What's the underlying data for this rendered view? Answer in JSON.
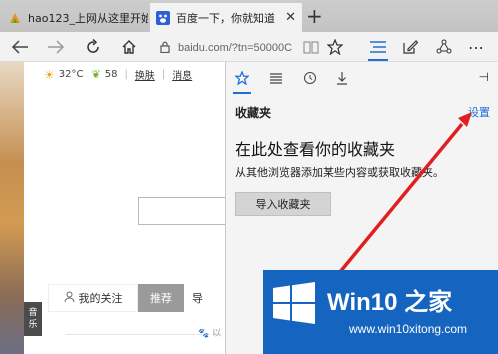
{
  "tabs": [
    {
      "title": "hao123_上网从这里开始",
      "active": false
    },
    {
      "title": "百度一下，你就知道",
      "active": true
    }
  ],
  "address_bar": {
    "url": "baidu.com/?tn=50000C"
  },
  "page": {
    "temperature": "32°C",
    "aqi": "58",
    "change_link": "换肤",
    "message_link": "消息",
    "tab_follow": "我的关注",
    "tab_recommend": "推荐",
    "tab_next": "导",
    "music_label": "音\n乐",
    "footer_hint": "以"
  },
  "hub": {
    "section_title": "收藏夹",
    "settings_link": "设置",
    "empty_heading": "在此处查看你的收藏夹",
    "empty_description": "从其他浏览器添加某些内容或获取收藏夹。",
    "import_button": "导入收藏夹",
    "tabs": [
      "favorites",
      "reading-list",
      "history",
      "downloads"
    ]
  },
  "watermark": {
    "brand": "Win10 之家",
    "url": "www.win10xitong.com"
  },
  "colors": {
    "accent": "#1e6ed6",
    "arrow": "#e02020",
    "watermark_bg": "#1565c0"
  }
}
